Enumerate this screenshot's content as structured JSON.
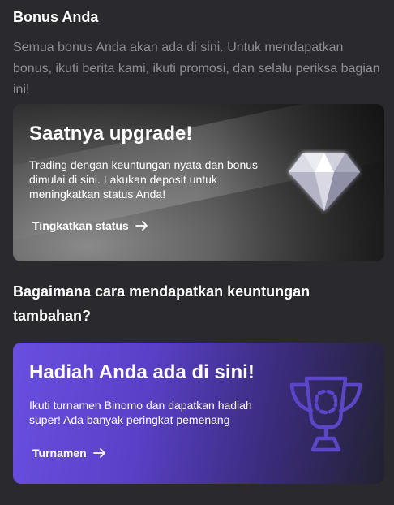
{
  "bonus_section": {
    "title": "Bonus Anda",
    "description": "Semua bonus Anda akan ada di sini. Untuk mendapatkan bonus, ikuti berita kami, ikuti promosi, dan selalu periksa bagian ini!"
  },
  "upgrade_card": {
    "title": "Saatnya upgrade!",
    "text": "Trading dengan keuntungan nyata dan bonus dimulai di sini. Lakukan deposit untuk meningkatkan status Anda!",
    "link_label": "Tingkatkan status",
    "icon": "diamond-icon"
  },
  "earn_section": {
    "title": "Bagaimana cara mendapatkan keuntungan tambahan?"
  },
  "tournament_card": {
    "title": "Hadiah Anda ada di sini!",
    "text": "Ikuti turnamen Binomo dan dapatkan hadiah super! Ada banyak peringkat pemenang",
    "link_label": "Turnamen",
    "icon": "trophy-icon"
  },
  "colors": {
    "background": "#2a2a2e",
    "muted_text": "#8e8e96",
    "tournament_accent": "#6a4fe0"
  }
}
